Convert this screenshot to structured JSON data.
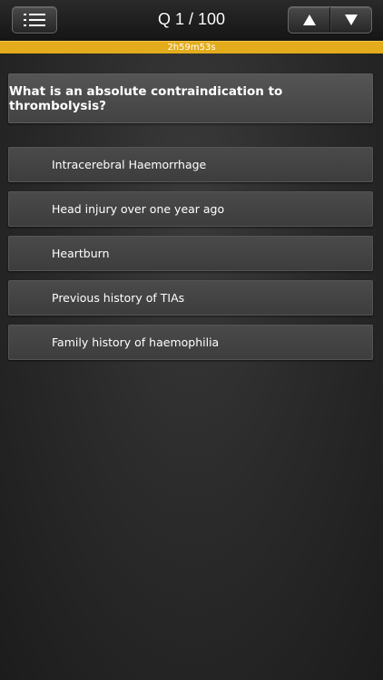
{
  "header": {
    "counter": "Q 1 / 100",
    "menu_icon": "list-icon",
    "prev_icon": "triangle-up-icon",
    "next_icon": "triangle-down-icon"
  },
  "timer": {
    "text": "2h59m53s",
    "color": "#e3ac1c"
  },
  "question": {
    "text": "What is an absolute contraindication to thrombolysis?"
  },
  "answers": [
    {
      "label": "Intracerebral Haemorrhage"
    },
    {
      "label": "Head injury over one year ago"
    },
    {
      "label": "Heartburn"
    },
    {
      "label": "Previous history of TIAs"
    },
    {
      "label": "Family history of haemophilia"
    }
  ]
}
